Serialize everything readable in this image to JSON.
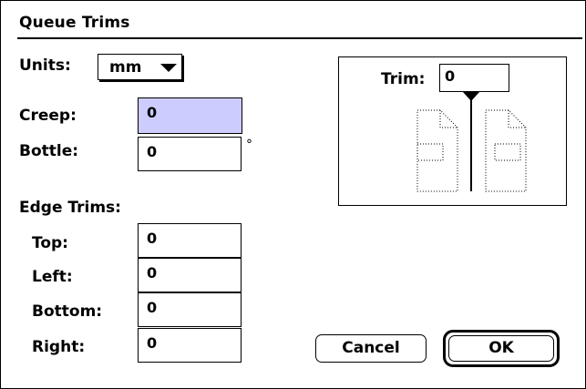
{
  "dialog": {
    "title": "Queue Trims"
  },
  "units": {
    "label": "Units:",
    "selected": "mm"
  },
  "creep": {
    "label": "Creep:",
    "value": "0"
  },
  "bottle": {
    "label": "Bottle:",
    "value": "0",
    "unit_symbol": "°"
  },
  "edge_trims": {
    "heading": "Edge Trims:",
    "fields": [
      {
        "label": "Top:",
        "value": "0"
      },
      {
        "label": "Left:",
        "value": "0"
      },
      {
        "label": "Bottom:",
        "value": "0"
      },
      {
        "label": "Right:",
        "value": "0"
      }
    ]
  },
  "preview": {
    "trim_label": "Trim:",
    "trim_value": "0"
  },
  "buttons": {
    "cancel": "Cancel",
    "ok": "OK"
  },
  "colors": {
    "focus_field": "#ccccff",
    "border": "#000000",
    "background": "#ffffff"
  },
  "icons": {
    "popup_arrow": "chevron-down-icon",
    "pages": "page-spread-icon",
    "trim_marker": "trim-marker-icon"
  }
}
